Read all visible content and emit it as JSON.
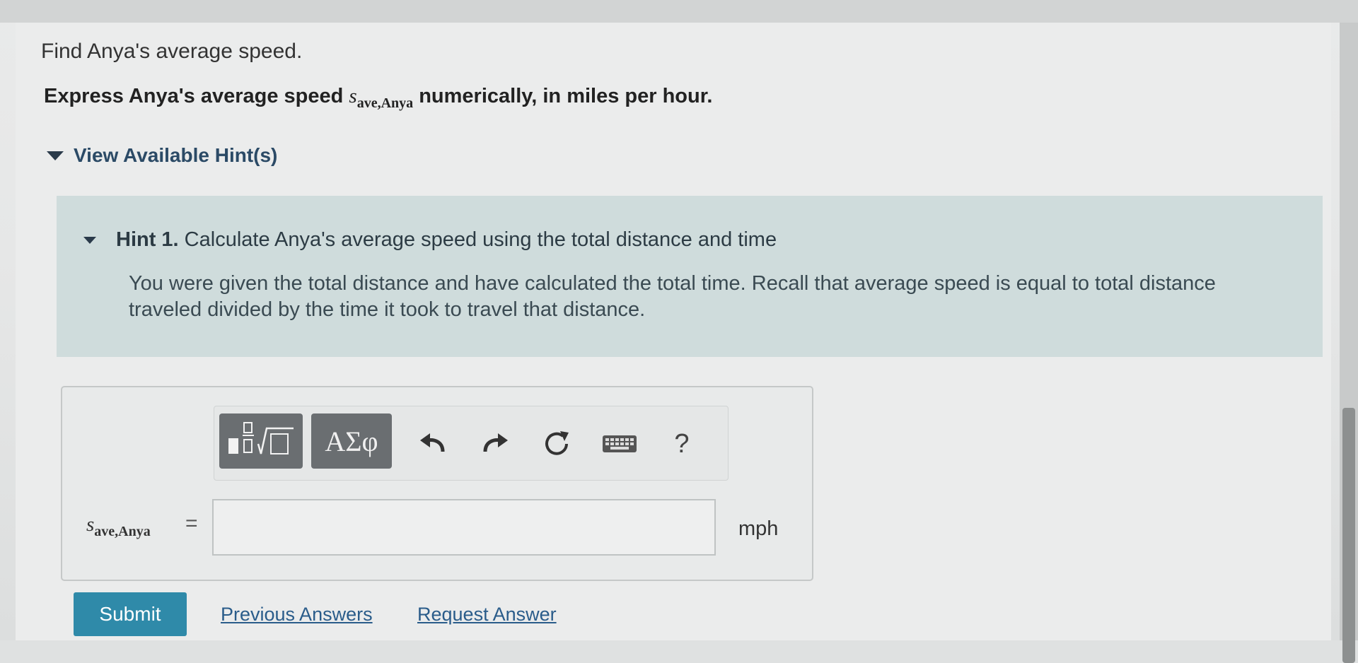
{
  "question": {
    "prompt": "Find Anya's average speed.",
    "instruction_before": "Express Anya's average speed ",
    "variable": "s",
    "variable_sub": "ave,Anya",
    "instruction_after": " numerically, in miles per hour."
  },
  "hints": {
    "toggle_label": "View Available Hint(s)",
    "hint1": {
      "number_label": "Hint 1.",
      "title": " Calculate Anya's average speed using the total distance and time",
      "body": "You were given the total distance and have calculated the total time. Recall that average speed is equal to total distance traveled divided by the time it took to travel that distance."
    }
  },
  "toolbar": {
    "greek_label": "ΑΣφ",
    "help_label": "?"
  },
  "answer": {
    "variable": "s",
    "variable_sub": "ave,Anya",
    "equals": "=",
    "value": "",
    "unit": "mph"
  },
  "actions": {
    "submit_label": "Submit",
    "previous_answers_label": "Previous Answers",
    "request_answer_label": "Request Answer"
  },
  "colors": {
    "submit_bg": "#2f8aa9",
    "hint_panel_bg": "#cfdcdc",
    "toolbar_button_bg": "#6a6e71",
    "link": "#2a5c8a"
  }
}
